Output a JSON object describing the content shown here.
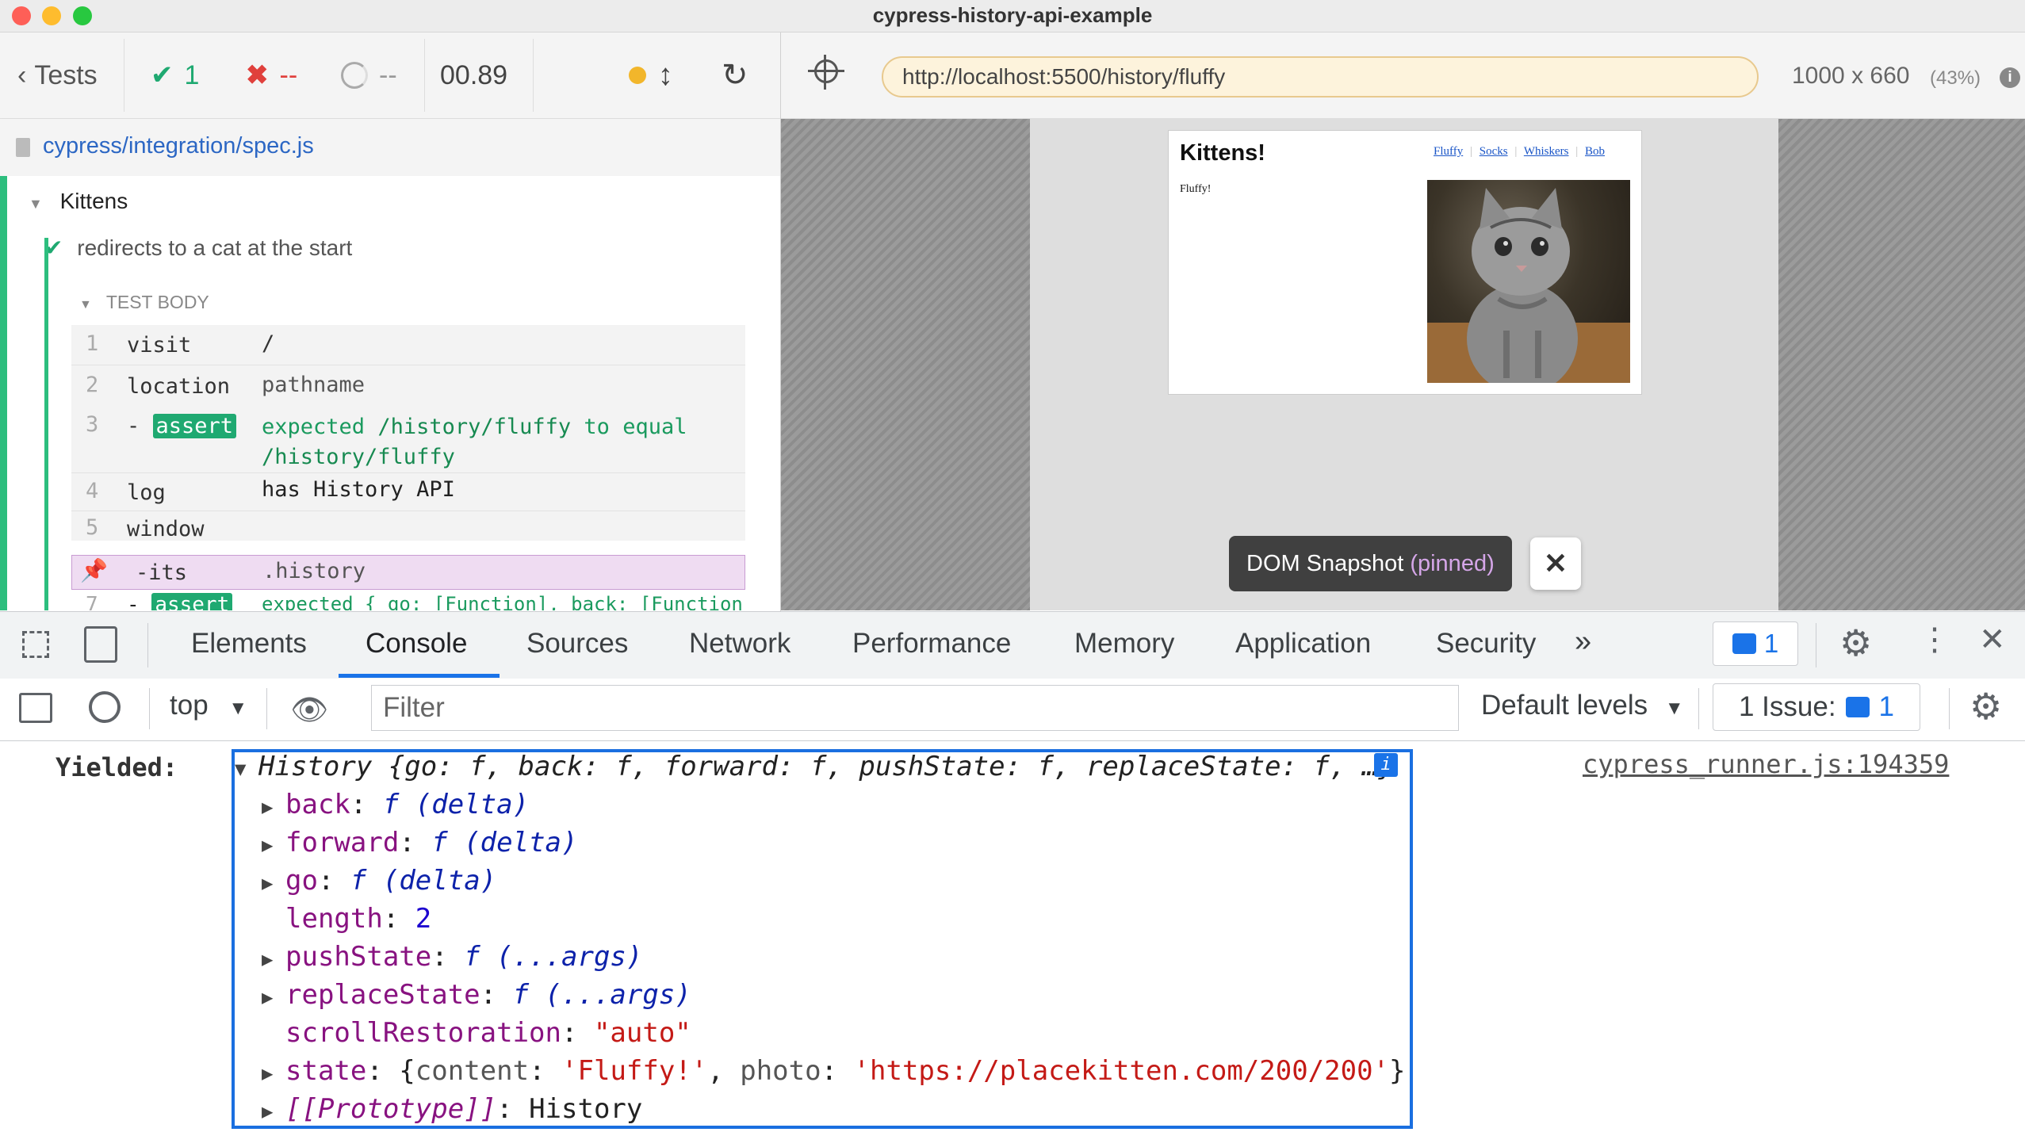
{
  "window": {
    "title": "cypress-history-api-example"
  },
  "runner": {
    "back_label": "Tests",
    "passed_count": "1",
    "failed_count": "--",
    "pending_count": "--",
    "duration": "00.89",
    "spec_path": "cypress/integration/spec.js",
    "suite_title": "Kittens",
    "test_title": "redirects to a cat at the start",
    "section_label": "TEST BODY",
    "commands": [
      {
        "num": "1",
        "name": "visit",
        "msg": "/"
      },
      {
        "num": "2",
        "name": "location",
        "msg": "pathname"
      },
      {
        "num": "3",
        "name": "assert",
        "msg_a": "expected",
        "msg_b": "/history/fluffy",
        "msg_c": "to equal",
        "msg_d": "/history/fluffy"
      },
      {
        "num": "4",
        "name": "log",
        "msg": "has History API"
      },
      {
        "num": "5",
        "name": "window",
        "msg": ""
      },
      {
        "num": "",
        "name": "-its",
        "msg": ".history"
      },
      {
        "num": "7",
        "name": "assert",
        "msg": "expected { go: [Function], back: [Function],"
      }
    ]
  },
  "aut": {
    "url": "http://localhost:5500/history/fluffy",
    "viewport": "1000 x 660",
    "scale": "(43%)",
    "page": {
      "heading": "Kittens!",
      "nav": [
        "Fluffy",
        "Socks",
        "Whiskers",
        "Bob"
      ],
      "content": "Fluffy!"
    },
    "snapshot_label": "DOM Snapshot",
    "snapshot_state": "(pinned)"
  },
  "devtools": {
    "tabs": [
      "Elements",
      "Console",
      "Sources",
      "Network",
      "Performance",
      "Memory",
      "Application",
      "Security"
    ],
    "active_tab": "Console",
    "message_count": "1",
    "context": "top",
    "filter_placeholder": "Filter",
    "levels": "Default levels",
    "issues_label": "1 Issue:",
    "issues_count": "1",
    "console": {
      "label": "Yielded:",
      "source": "cypress_runner.js:194359",
      "summary": "History {go: f, back: f, forward: f, pushState: f, replaceState: f, …}",
      "props": {
        "back": {
          "key": "back",
          "val": "f (delta)"
        },
        "forward": {
          "key": "forward",
          "val": "f (delta)"
        },
        "go": {
          "key": "go",
          "val": "f (delta)"
        },
        "length": {
          "key": "length",
          "val": "2"
        },
        "pushState": {
          "key": "pushState",
          "val": "f (...args)"
        },
        "replaceState": {
          "key": "replaceState",
          "val": "f (...args)"
        },
        "scrollRestoration": {
          "key": "scrollRestoration",
          "val": "\"auto\""
        },
        "state": {
          "key": "state",
          "content_key": "content",
          "content_val": "'Fluffy!'",
          "photo_key": "photo",
          "photo_val": "'https://placekitten.com/200/200'"
        },
        "prototype": {
          "key": "[[Prototype]]",
          "val": "History"
        }
      }
    }
  }
}
